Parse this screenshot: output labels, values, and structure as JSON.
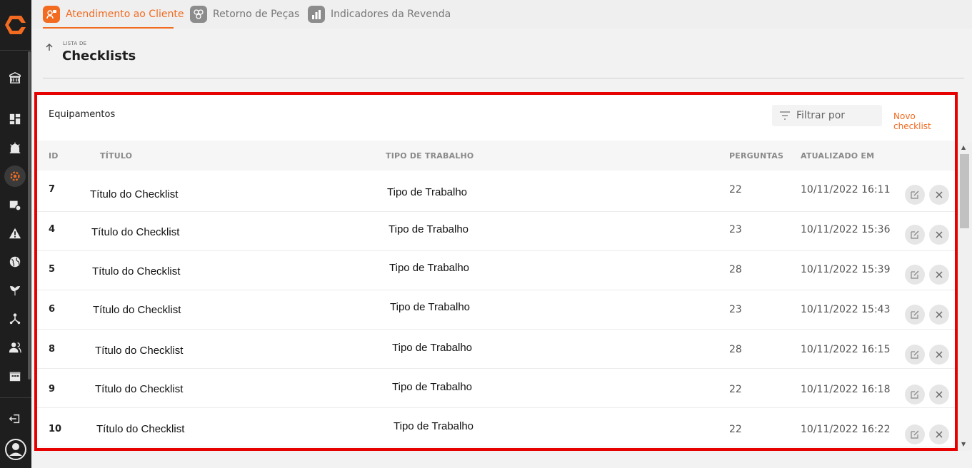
{
  "tabs": [
    {
      "label": "Atendimento ao Cliente",
      "active": true,
      "icon": "support-agent-icon"
    },
    {
      "label": "Retorno de Peças",
      "active": false,
      "icon": "parts-return-icon"
    },
    {
      "label": "Indicadores da Revenda",
      "active": false,
      "icon": "bar-chart-icon"
    }
  ],
  "header": {
    "kicker": "LISTA DE",
    "title": "Checklists"
  },
  "panel": {
    "title": "Equipamentos",
    "filter_placeholder": "Filtrar por",
    "new_label": "Novo checklist"
  },
  "table": {
    "columns": [
      "ID",
      "TÍTULO",
      "TIPO DE TRABALHO",
      "PERGUNTAS",
      "ATUALIZADO EM"
    ],
    "rows": [
      {
        "id": "7",
        "title": "Título do Checklist",
        "type": "Tipo de Trabalho",
        "questions": "22",
        "updated": "10/11/2022 16:11"
      },
      {
        "id": "4",
        "title": "Título do Checklist",
        "type": "Tipo de Trabalho",
        "questions": "23",
        "updated": "10/11/2022 15:36"
      },
      {
        "id": "5",
        "title": "Título do Checklist",
        "type": "Tipo de Trabalho",
        "questions": "28",
        "updated": "10/11/2022 15:39"
      },
      {
        "id": "6",
        "title": "Título do Checklist",
        "type": "Tipo de Trabalho",
        "questions": "23",
        "updated": "10/11/2022 15:43"
      },
      {
        "id": "8",
        "title": "Título do Checklist",
        "type": "Tipo de Trabalho",
        "questions": "28",
        "updated": "10/11/2022 16:15"
      },
      {
        "id": "9",
        "title": "Título do Checklist",
        "type": "Tipo de Trabalho",
        "questions": "22",
        "updated": "10/11/2022 16:18"
      },
      {
        "id": "10",
        "title": "Título do Checklist",
        "type": "Tipo de Trabalho",
        "questions": "22",
        "updated": "10/11/2022 16:22"
      }
    ]
  },
  "colors": {
    "accent": "#f26b21",
    "sidebar": "#1e1e1e",
    "highlight_border": "#e60000"
  }
}
